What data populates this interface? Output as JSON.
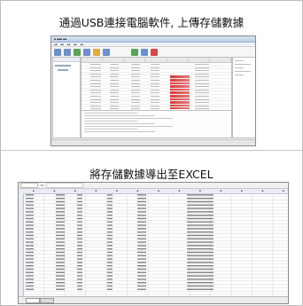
{
  "captions": {
    "top": "通過USB連接電腦軟件, 上傳存儲數據",
    "bottom": "將存儲數據導出至EXCEL"
  },
  "colors": {
    "excel_grid": "#d4d4d4",
    "highlight": "#d73a3a",
    "excel_header": "#e9edf3"
  },
  "icons": [
    "toolbar-icon",
    "graph-icon"
  ]
}
